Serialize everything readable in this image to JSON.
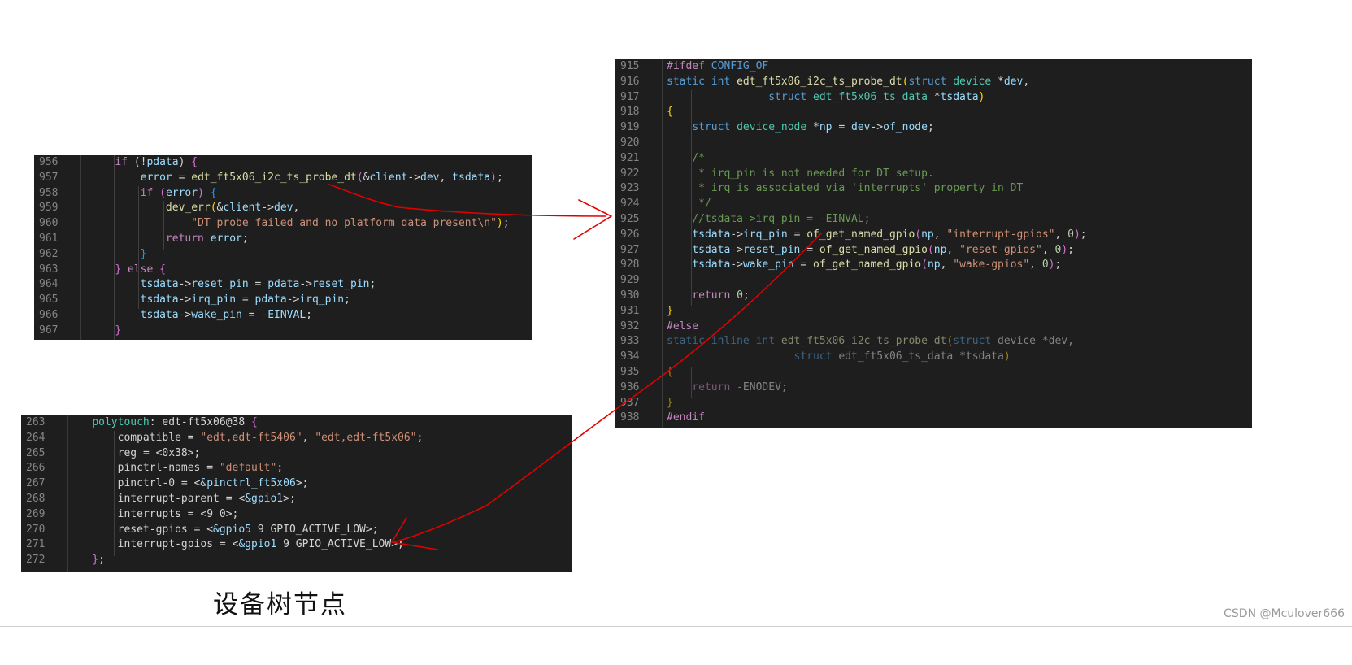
{
  "panel_left": {
    "lines": [
      {
        "n": "956",
        "html": "    <span class=\"kw\">if</span> <span class=\"p\">(</span><span class=\"p\">!</span><span class=\"va\">pdata</span><span class=\"p\">)</span> <span class=\"m\">{</span>"
      },
      {
        "n": "957",
        "html": "        <span class=\"va\">error</span> <span class=\"p\">=</span> <span class=\"fn\">edt_ft5x06_i2c_ts_probe_dt</span><span class=\"m\">(</span><span class=\"p\">&amp;</span><span class=\"va\">client</span><span class=\"p\">-&gt;</span><span class=\"va\">dev</span><span class=\"p\">,</span> <span class=\"va\">tsdata</span><span class=\"m\">)</span><span class=\"p\">;</span>"
      },
      {
        "n": "958",
        "html": "        <span class=\"kw\">if</span> <span class=\"m\">(</span><span class=\"va\">error</span><span class=\"m\">)</span> <span class=\"b\">{</span>"
      },
      {
        "n": "959",
        "html": "            <span class=\"fn\">dev_err</span><span class=\"y\">(</span><span class=\"p\">&amp;</span><span class=\"va\">client</span><span class=\"p\">-&gt;</span><span class=\"va\">dev</span><span class=\"p\">,</span>"
      },
      {
        "n": "960",
        "html": "                <span class=\"s\">\"DT probe failed and no platform data present\\n\"</span><span class=\"y\">)</span><span class=\"p\">;</span>"
      },
      {
        "n": "961",
        "html": "            <span class=\"kw\">return</span> <span class=\"va\">error</span><span class=\"p\">;</span>"
      },
      {
        "n": "962",
        "html": "        <span class=\"b\">}</span>"
      },
      {
        "n": "963",
        "html": "    <span class=\"m\">}</span> <span class=\"kw\">else</span> <span class=\"m\">{</span>"
      },
      {
        "n": "964",
        "html": "        <span class=\"va\">tsdata</span><span class=\"p\">-&gt;</span><span class=\"va\">reset_pin</span> <span class=\"p\">=</span> <span class=\"va\">pdata</span><span class=\"p\">-&gt;</span><span class=\"va\">reset_pin</span><span class=\"p\">;</span>"
      },
      {
        "n": "965",
        "html": "        <span class=\"va\">tsdata</span><span class=\"p\">-&gt;</span><span class=\"va\">irq_pin</span> <span class=\"p\">=</span> <span class=\"va\">pdata</span><span class=\"p\">-&gt;</span><span class=\"va\">irq_pin</span><span class=\"p\">;</span>"
      },
      {
        "n": "966",
        "html": "        <span class=\"va\">tsdata</span><span class=\"p\">-&gt;</span><span class=\"va\">wake_pin</span> <span class=\"p\">=</span> <span class=\"p\">-</span><span class=\"va\">EINVAL</span><span class=\"p\">;</span>"
      },
      {
        "n": "967",
        "html": "    <span class=\"m\">}</span>"
      }
    ]
  },
  "panel_right": {
    "lines": [
      {
        "n": "915",
        "html": "<span class=\"kw\">#ifdef</span> <span class=\"ty\">CONFIG_OF</span>"
      },
      {
        "n": "916",
        "html": "<span class=\"ty\">static</span> <span class=\"ty\">int</span> <span class=\"fn\">edt_ft5x06_i2c_ts_probe_dt</span><span class=\"y\">(</span><span class=\"ty\">struct</span> <span class=\"st\">device</span> <span class=\"p\">*</span><span class=\"va\">dev</span><span class=\"p\">,</span>"
      },
      {
        "n": "917",
        "html": "                <span class=\"ty\">struct</span> <span class=\"st\">edt_ft5x06_ts_data</span> <span class=\"p\">*</span><span class=\"va\">tsdata</span><span class=\"y\">)</span>"
      },
      {
        "n": "918",
        "html": "<span class=\"y\">{</span>"
      },
      {
        "n": "919",
        "html": "    <span class=\"ty\">struct</span> <span class=\"st\">device_node</span> <span class=\"p\">*</span><span class=\"va\">np</span> <span class=\"p\">=</span> <span class=\"va\">dev</span><span class=\"p\">-&gt;</span><span class=\"va\">of_node</span><span class=\"p\">;</span>"
      },
      {
        "n": "920",
        "html": ""
      },
      {
        "n": "921",
        "html": "    <span class=\"c\">/*</span>"
      },
      {
        "n": "922",
        "html": "    <span class=\"c\"> * irq_pin is not needed for DT setup.</span>"
      },
      {
        "n": "923",
        "html": "    <span class=\"c\"> * irq is associated via 'interrupts' property in DT</span>"
      },
      {
        "n": "924",
        "html": "    <span class=\"c\"> */</span>"
      },
      {
        "n": "925",
        "html": "    <span class=\"c\">//tsdata-&gt;irq_pin = -EINVAL;</span>"
      },
      {
        "n": "926",
        "html": "    <span class=\"va\">tsdata</span><span class=\"p\">-&gt;</span><span class=\"va\">irq_pin</span> <span class=\"p\">=</span> <span class=\"fn\">of_get_named_gpio</span><span class=\"m\">(</span><span class=\"va\">np</span><span class=\"p\">,</span> <span class=\"s\">\"interrupt-gpios\"</span><span class=\"p\">,</span> <span class=\"n\">0</span><span class=\"m\">)</span><span class=\"p\">;</span>"
      },
      {
        "n": "927",
        "html": "    <span class=\"va\">tsdata</span><span class=\"p\">-&gt;</span><span class=\"va\">reset_pin</span> <span class=\"p\">=</span> <span class=\"fn\">of_get_named_gpio</span><span class=\"m\">(</span><span class=\"va\">np</span><span class=\"p\">,</span> <span class=\"s\">\"reset-gpios\"</span><span class=\"p\">,</span> <span class=\"n\">0</span><span class=\"m\">)</span><span class=\"p\">;</span>"
      },
      {
        "n": "928",
        "html": "    <span class=\"va\">tsdata</span><span class=\"p\">-&gt;</span><span class=\"va\">wake_pin</span> <span class=\"p\">=</span> <span class=\"fn\">of_get_named_gpio</span><span class=\"m\">(</span><span class=\"va\">np</span><span class=\"p\">,</span> <span class=\"s\">\"wake-gpios\"</span><span class=\"p\">,</span> <span class=\"n\">0</span><span class=\"m\">)</span><span class=\"p\">;</span>"
      },
      {
        "n": "929",
        "html": ""
      },
      {
        "n": "930",
        "html": "    <span class=\"kw\">return</span> <span class=\"n\">0</span><span class=\"p\">;</span>"
      },
      {
        "n": "931",
        "html": "<span class=\"y\">}</span>"
      },
      {
        "n": "932",
        "html": "<span class=\"kw\">#else</span>"
      },
      {
        "n": "933",
        "html": "<span class=\"dim\"><span class=\"ty\">static</span> <span class=\"ty\">inline</span> <span class=\"ty\">int</span> <span class=\"fn\">edt_ft5x06_i2c_ts_probe_dt</span><span class=\"y\">(</span><span class=\"ty\">struct</span> <span class=\"p\">device</span> <span class=\"p\">*dev,</span></span>"
      },
      {
        "n": "934",
        "html": "<span class=\"dim\">                    <span class=\"ty\">struct</span> <span class=\"p\">edt_ft5x06_ts_data</span> <span class=\"p\">*tsdata</span><span class=\"y\">)</span></span>"
      },
      {
        "n": "935",
        "html": "<span class=\"dim\"><span class=\"y\">{</span></span>"
      },
      {
        "n": "936",
        "html": "<span class=\"dim\">    <span class=\"kw\">return</span> <span class=\"p\">-ENODEV;</span></span>"
      },
      {
        "n": "937",
        "html": "<span class=\"dim\"><span class=\"y\">}</span></span>"
      },
      {
        "n": "938",
        "html": "<span class=\"kw\">#endif</span>"
      }
    ]
  },
  "panel_dts": {
    "lines": [
      {
        "n": "263",
        "html": "    <span class=\"st\">polytouch</span><span class=\"p\">:</span> <span class=\"p\">edt-ft5x06@38</span> <span class=\"m\">{</span>"
      },
      {
        "n": "264",
        "html": "        <span class=\"p\">compatible</span> <span class=\"p\">=</span> <span class=\"s\">\"edt,edt-ft5406\"</span><span class=\"p\">,</span> <span class=\"s\">\"edt,edt-ft5x06\"</span><span class=\"p\">;</span>"
      },
      {
        "n": "265",
        "html": "        <span class=\"p\">reg</span> <span class=\"p\">=</span> <span class=\"p\">&lt;0x38&gt;;</span>"
      },
      {
        "n": "266",
        "html": "        <span class=\"p\">pinctrl-names</span> <span class=\"p\">=</span> <span class=\"s\">\"default\"</span><span class=\"p\">;</span>"
      },
      {
        "n": "267",
        "html": "        <span class=\"p\">pinctrl-0</span> <span class=\"p\">=</span> <span class=\"p\">&lt;</span><span class=\"va\">&amp;pinctrl_ft5x06</span><span class=\"p\">&gt;;</span>"
      },
      {
        "n": "268",
        "html": "        <span class=\"p\">interrupt-parent</span> <span class=\"p\">=</span> <span class=\"p\">&lt;</span><span class=\"va\">&amp;gpio1</span><span class=\"p\">&gt;;</span>"
      },
      {
        "n": "269",
        "html": "        <span class=\"p\">interrupts</span> <span class=\"p\">=</span> <span class=\"p\">&lt;9 0&gt;;</span>"
      },
      {
        "n": "270",
        "html": "        <span class=\"p\">reset-gpios</span> <span class=\"p\">=</span> <span class=\"p\">&lt;</span><span class=\"va\">&amp;gpio5</span> <span class=\"p\">9 GPIO_ACTIVE_LOW&gt;;</span>"
      },
      {
        "n": "271",
        "html": "        <span class=\"p\">interrupt-gpios</span> <span class=\"p\">=</span> <span class=\"p\">&lt;</span><span class=\"va\">&amp;gpio1</span> <span class=\"p\">9 GPIO_ACTIVE_LOW&gt;;</span>"
      },
      {
        "n": "272",
        "html": "    <span class=\"m\">}</span><span class=\"p\">;</span>"
      }
    ]
  },
  "caption": "设备树节点",
  "watermark": "CSDN @Mculover666",
  "colors": {
    "arrow": "#e00000",
    "panel_bg": "#1e1e1e"
  }
}
